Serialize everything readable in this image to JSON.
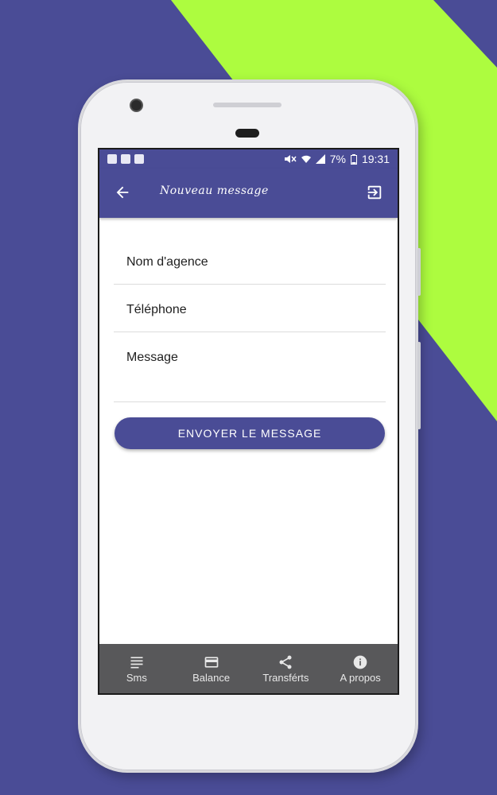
{
  "status_bar": {
    "battery": "7%",
    "time": "19:31"
  },
  "app_bar": {
    "title": "Nouveau message"
  },
  "form": {
    "agency_placeholder": "Nom d'agence",
    "phone_placeholder": "Téléphone",
    "message_placeholder": "Message",
    "send_button": "ENVOYER LE MESSAGE"
  },
  "bottom_nav": {
    "items": [
      {
        "label": "Sms",
        "icon": "text-lines-icon"
      },
      {
        "label": "Balance",
        "icon": "credit-card-icon"
      },
      {
        "label": "Transférts",
        "icon": "share-icon"
      },
      {
        "label": "A propos",
        "icon": "info-icon"
      }
    ]
  },
  "colors": {
    "primary": "#4a4c96",
    "accent_background": "#adfc3f",
    "bottom_nav": "#58585a"
  }
}
